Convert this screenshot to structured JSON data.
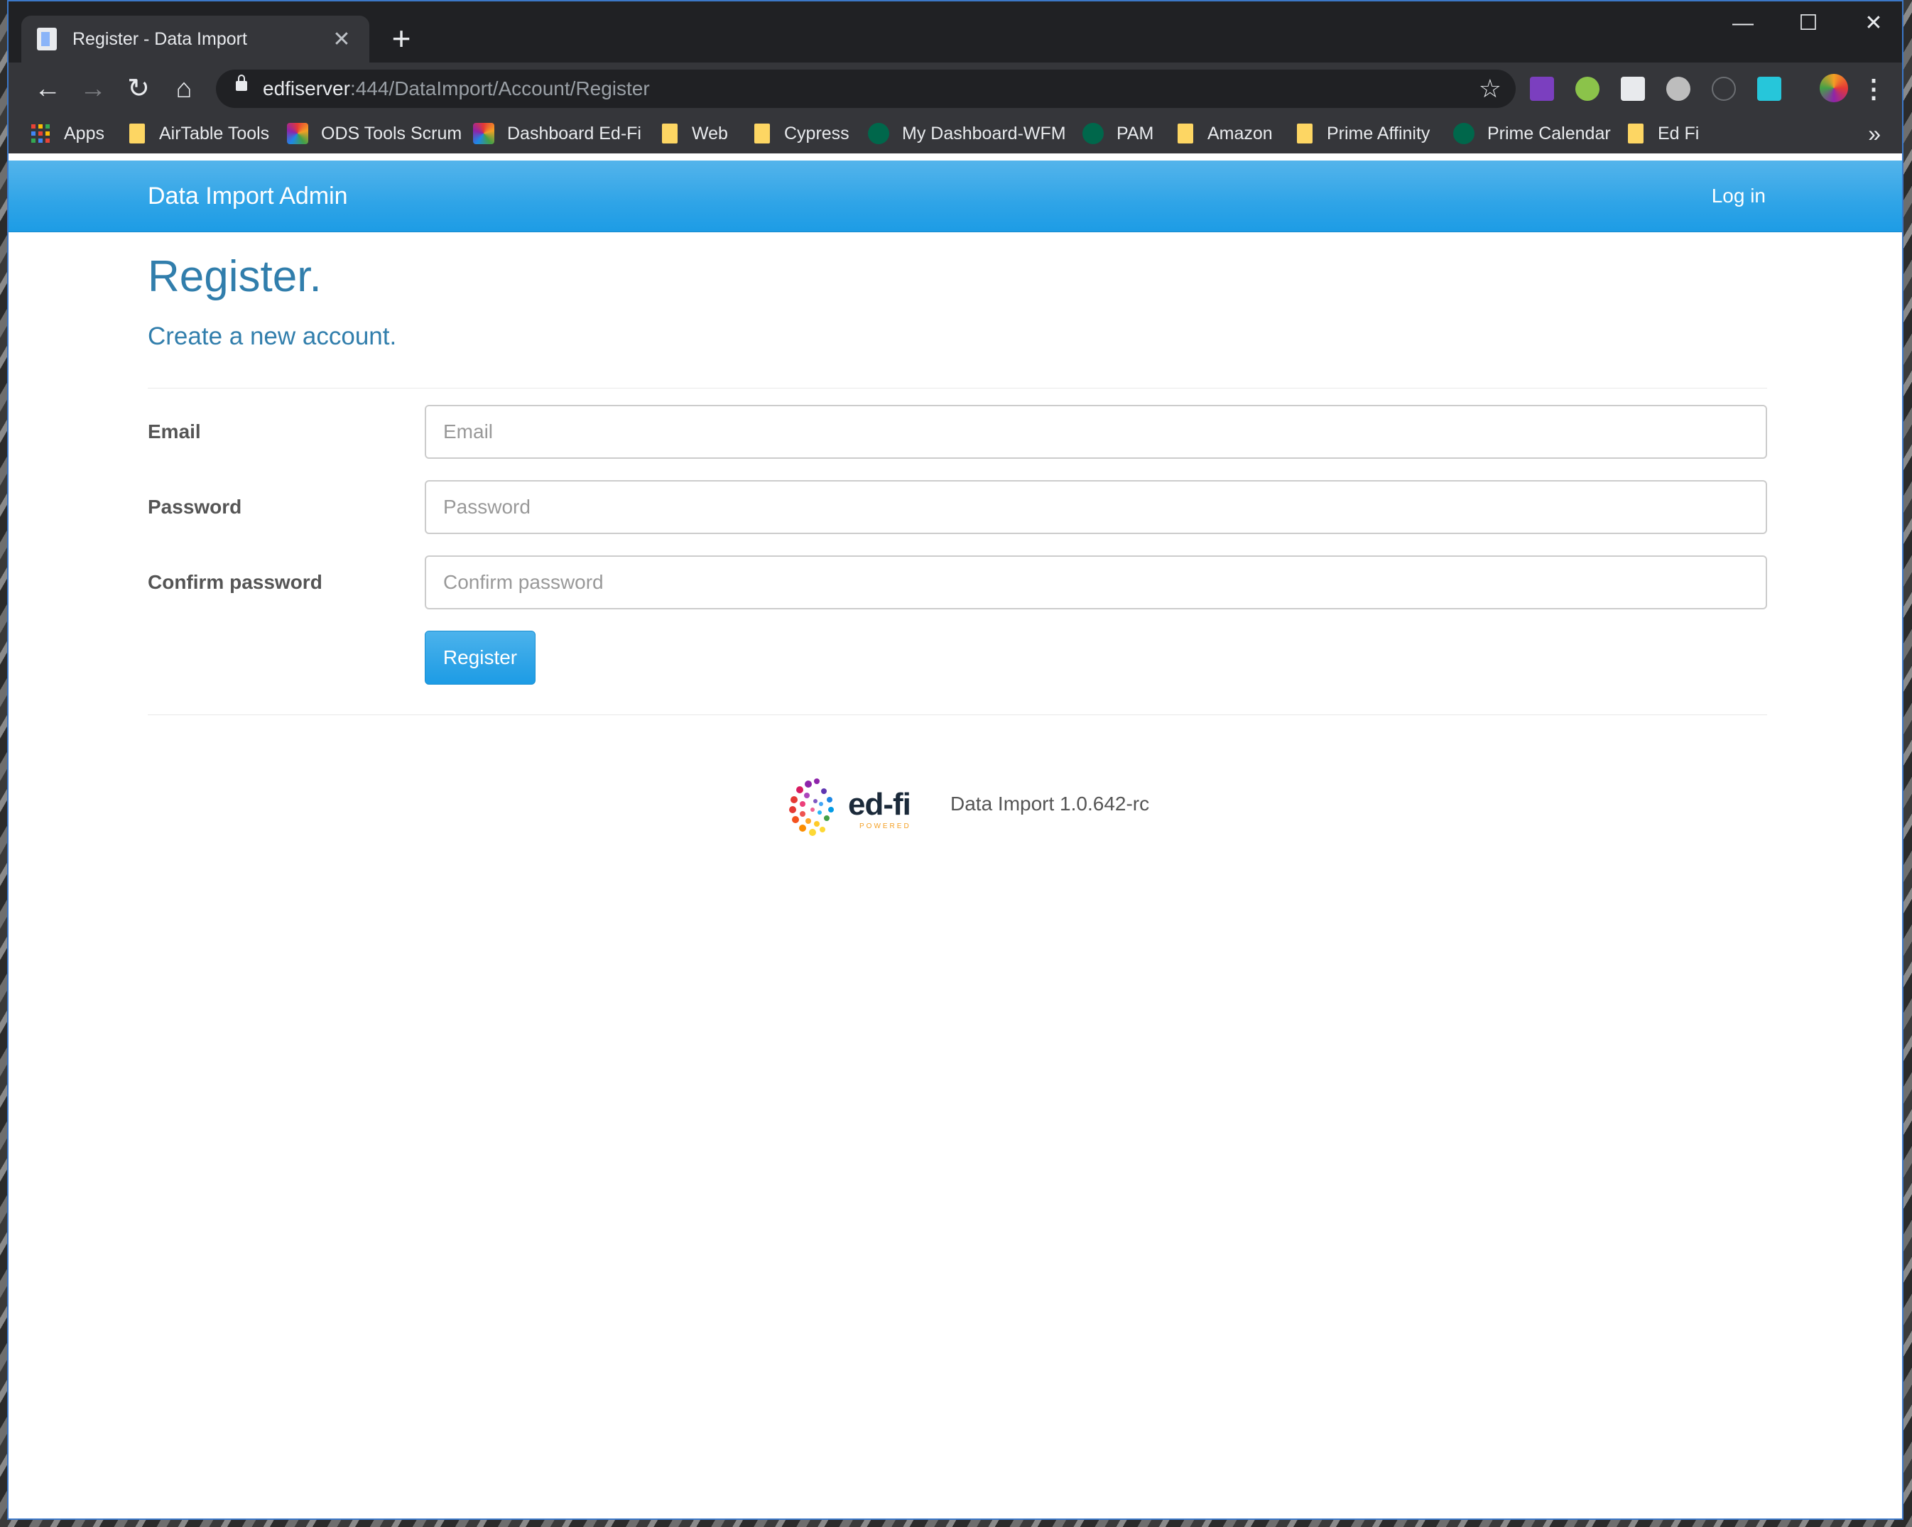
{
  "browser": {
    "tab_title": "Register - Data Import",
    "url_host": "edfiserver",
    "url_rest": ":444/DataImport/Account/Register",
    "bookmarks": [
      {
        "label": "Apps",
        "icon": "apps-grid-icon"
      },
      {
        "label": "AirTable Tools",
        "icon": "folder-icon"
      },
      {
        "label": "ODS Tools Scrum",
        "icon": "dashboard-favicon"
      },
      {
        "label": "Dashboard Ed-Fi",
        "icon": "dashboard-favicon"
      },
      {
        "label": "Web",
        "icon": "folder-icon"
      },
      {
        "label": "Cypress",
        "icon": "folder-icon"
      },
      {
        "label": "My Dashboard-WFM",
        "icon": "wfm-favicon"
      },
      {
        "label": "PAM",
        "icon": "wfm-favicon"
      },
      {
        "label": "Amazon",
        "icon": "folder-icon"
      },
      {
        "label": "Prime Affinity",
        "icon": "folder-icon"
      },
      {
        "label": "Prime Calendar",
        "icon": "wfm-favicon"
      },
      {
        "label": "Ed Fi",
        "icon": "folder-icon"
      }
    ]
  },
  "navbar": {
    "brand": "Data Import Admin",
    "login": "Log in"
  },
  "page": {
    "title": "Register.",
    "subtitle": "Create a new account."
  },
  "form": {
    "email_label": "Email",
    "email_placeholder": "Email",
    "password_label": "Password",
    "password_placeholder": "Password",
    "confirm_label": "Confirm password",
    "confirm_placeholder": "Confirm password",
    "submit_label": "Register"
  },
  "footer": {
    "logo_text": "ed-fi",
    "logo_tagline": "POWERED",
    "version": "Data Import 1.0.642-rc"
  },
  "colors": {
    "navbar": "#2fa4e7",
    "heading": "#317eac",
    "button": "#2fa4e7"
  }
}
